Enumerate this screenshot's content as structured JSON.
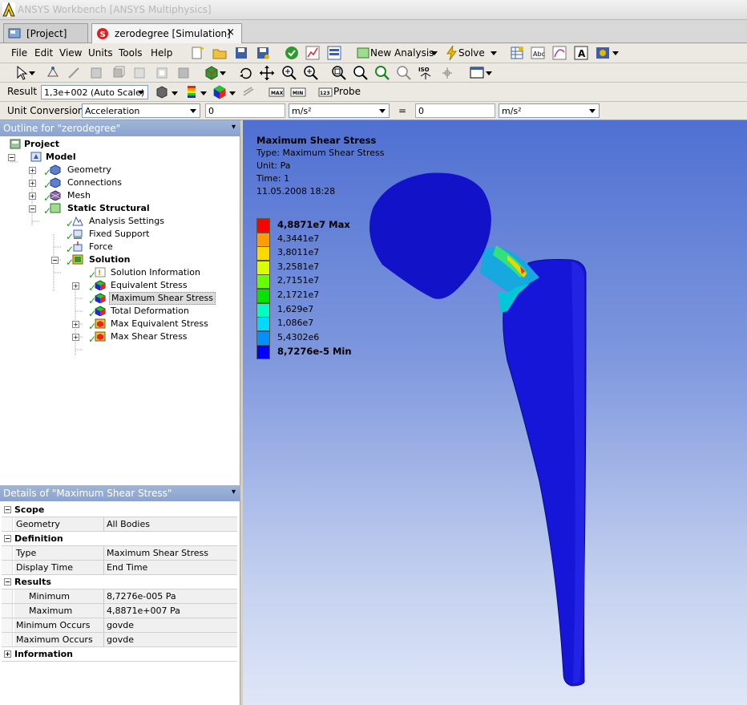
{
  "window": {
    "title": "ANSYS Workbench [ANSYS Multiphysics]"
  },
  "tabs": [
    {
      "label": "[Project]",
      "icon": "project-icon"
    },
    {
      "label": "zerodegree [Simulation]",
      "icon": "simulation-icon",
      "close": "×"
    }
  ],
  "menu": [
    "File",
    "Edit",
    "View",
    "Units",
    "Tools",
    "Help"
  ],
  "toolbar": {
    "new_analysis_label": "New Analysis",
    "solve_label": "Solve"
  },
  "result_bar": {
    "result_label": "Result",
    "scale_value": "1,3e+002 (Auto Scale)",
    "max_label": "MAX",
    "min_label": "MIN",
    "probe_label": "Probe"
  },
  "unit_bar": {
    "label": "Unit Conversion",
    "quantity": "Acceleration",
    "value_left": "0",
    "unit_left": "m/s²",
    "equals": "=",
    "value_right": "0",
    "unit_right": "m/s²"
  },
  "outline": {
    "header": "Outline for \"zerodegree\"",
    "pin": "▾",
    "items": [
      {
        "label": "Project",
        "bold": true
      },
      {
        "label": "Model",
        "bold": true
      },
      {
        "label": "Geometry"
      },
      {
        "label": "Connections"
      },
      {
        "label": "Mesh"
      },
      {
        "label": "Static Structural",
        "bold": true
      },
      {
        "label": "Analysis Settings"
      },
      {
        "label": "Fixed Support"
      },
      {
        "label": "Force"
      },
      {
        "label": "Solution",
        "bold": true
      },
      {
        "label": "Solution Information"
      },
      {
        "label": "Equivalent Stress"
      },
      {
        "label": "Maximum Shear Stress",
        "selected": true
      },
      {
        "label": "Total Deformation"
      },
      {
        "label": "Max Equivalent Stress"
      },
      {
        "label": "Max Shear Stress"
      }
    ]
  },
  "details": {
    "header": "Details of \"Maximum Shear Stress\"",
    "scope_label": "Scope",
    "geometry_key": "Geometry",
    "geometry_value": "All Bodies",
    "definition_label": "Definition",
    "type_key": "Type",
    "type_value": "Maximum Shear Stress",
    "display_time_key": "Display Time",
    "display_time_value": "End Time",
    "results_label": "Results",
    "minimum_key": "Minimum",
    "minimum_value": "8,7276e-005 Pa",
    "maximum_key": "Maximum",
    "maximum_value": "4,8871e+007 Pa",
    "min_occurs_key": "Minimum Occurs On",
    "min_occurs_value": "govde",
    "max_occurs_key": "Maximum Occurs On",
    "max_occurs_value": "govde",
    "information_label": "Information"
  },
  "result_info": {
    "title": "Maximum Shear Stress",
    "type": "Type: Maximum Shear Stress",
    "unit": "Unit: Pa",
    "time": "Time: 1",
    "date": "11.05.2008 18:28"
  },
  "legend": [
    {
      "label": "4,8871e7 Max",
      "color": "#ff0000",
      "bold": true
    },
    {
      "label": "4,3441e7",
      "color": "#ff9c00"
    },
    {
      "label": "3,8011e7",
      "color": "#ffd800"
    },
    {
      "label": "3,2581e7",
      "color": "#d9ff00"
    },
    {
      "label": "2,7151e7",
      "color": "#66ff00"
    },
    {
      "label": "2,1721e7",
      "color": "#00e400"
    },
    {
      "label": "1,629e7",
      "color": "#00ffc0"
    },
    {
      "label": "1,086e7",
      "color": "#00d8ff"
    },
    {
      "label": "5,4302e6",
      "color": "#0090ff"
    },
    {
      "label": "8,7276e-5 Min",
      "color": "#0000ff",
      "bold": true
    }
  ]
}
